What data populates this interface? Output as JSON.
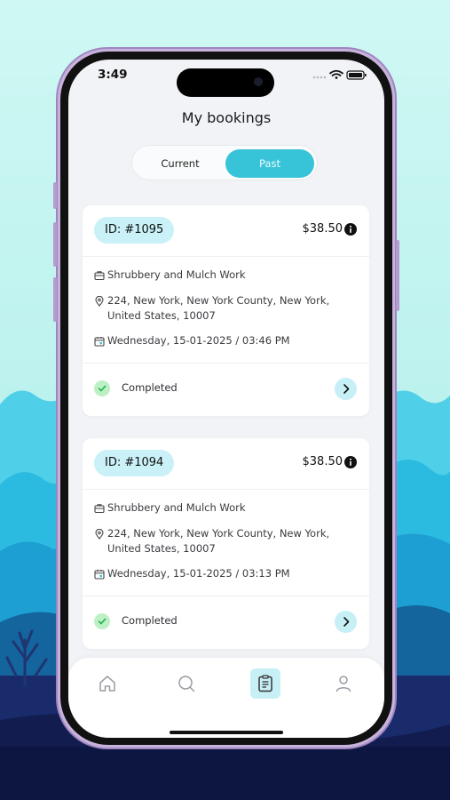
{
  "status_bar": {
    "time": "3:49"
  },
  "page": {
    "title": "My bookings"
  },
  "tabs": {
    "current_label": "Current",
    "past_label": "Past",
    "active": "Past"
  },
  "bookings": [
    {
      "id": "ID: #1095",
      "price": "$38.50",
      "service": "Shrubbery and Mulch Work",
      "address": "224, New York, New York County, New York, United States, 10007",
      "datetime": "Wednesday, 15-01-2025 / 03:46 PM",
      "status": "Completed"
    },
    {
      "id": "ID: #1094",
      "price": "$38.50",
      "service": "Shrubbery and Mulch Work",
      "address": "224, New York, New York County, New York, United States, 10007",
      "datetime": "Wednesday, 15-01-2025 / 03:13 PM",
      "status": "Completed"
    }
  ],
  "bottom_nav": {
    "items": [
      "home-icon",
      "search-icon",
      "bookings-icon",
      "profile-icon"
    ],
    "active": "bookings-icon"
  },
  "colors": {
    "accent": "#38c4d8",
    "accent_light": "#c7f0f6",
    "success": "#22b04a",
    "success_bg": "#bdf0c4"
  }
}
